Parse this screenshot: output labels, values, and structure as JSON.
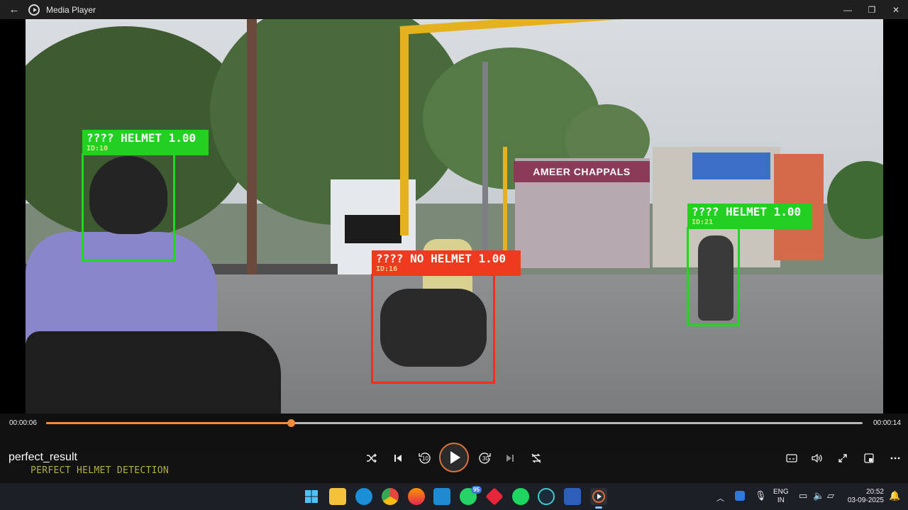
{
  "window": {
    "title": "Media Player",
    "back_glyph": "←",
    "minimize_glyph": "—",
    "restore_glyph": "❐",
    "close_glyph": "✕"
  },
  "detections": [
    {
      "label": "???? HELMET 1.00",
      "id_text": "ID:10",
      "status": "helmet",
      "color": "#22d022"
    },
    {
      "label": "???? NO HELMET 1.00",
      "id_text": "ID:16",
      "status": "no-helmet",
      "color": "#ee3a1f"
    },
    {
      "label": "???? HELMET 1.00",
      "id_text": "ID:21",
      "status": "helmet",
      "color": "#22d022"
    }
  ],
  "scene": {
    "shop_sign": "AMEER CHAPPALS"
  },
  "player": {
    "current_time": "00:00:06",
    "total_time": "00:00:14",
    "progress_fraction": 0.3,
    "file_name": "perfect_result",
    "caption": "PERFECT HELMET DETECTION",
    "skip_back_seconds": "10",
    "skip_forward_seconds": "30",
    "accent_color": "#f38a3c"
  },
  "taskbar": {
    "whatsapp_badge": "95",
    "language_line1": "ENG",
    "language_line2": "IN",
    "clock_time": "20:52",
    "clock_date": "03-09-2025"
  }
}
